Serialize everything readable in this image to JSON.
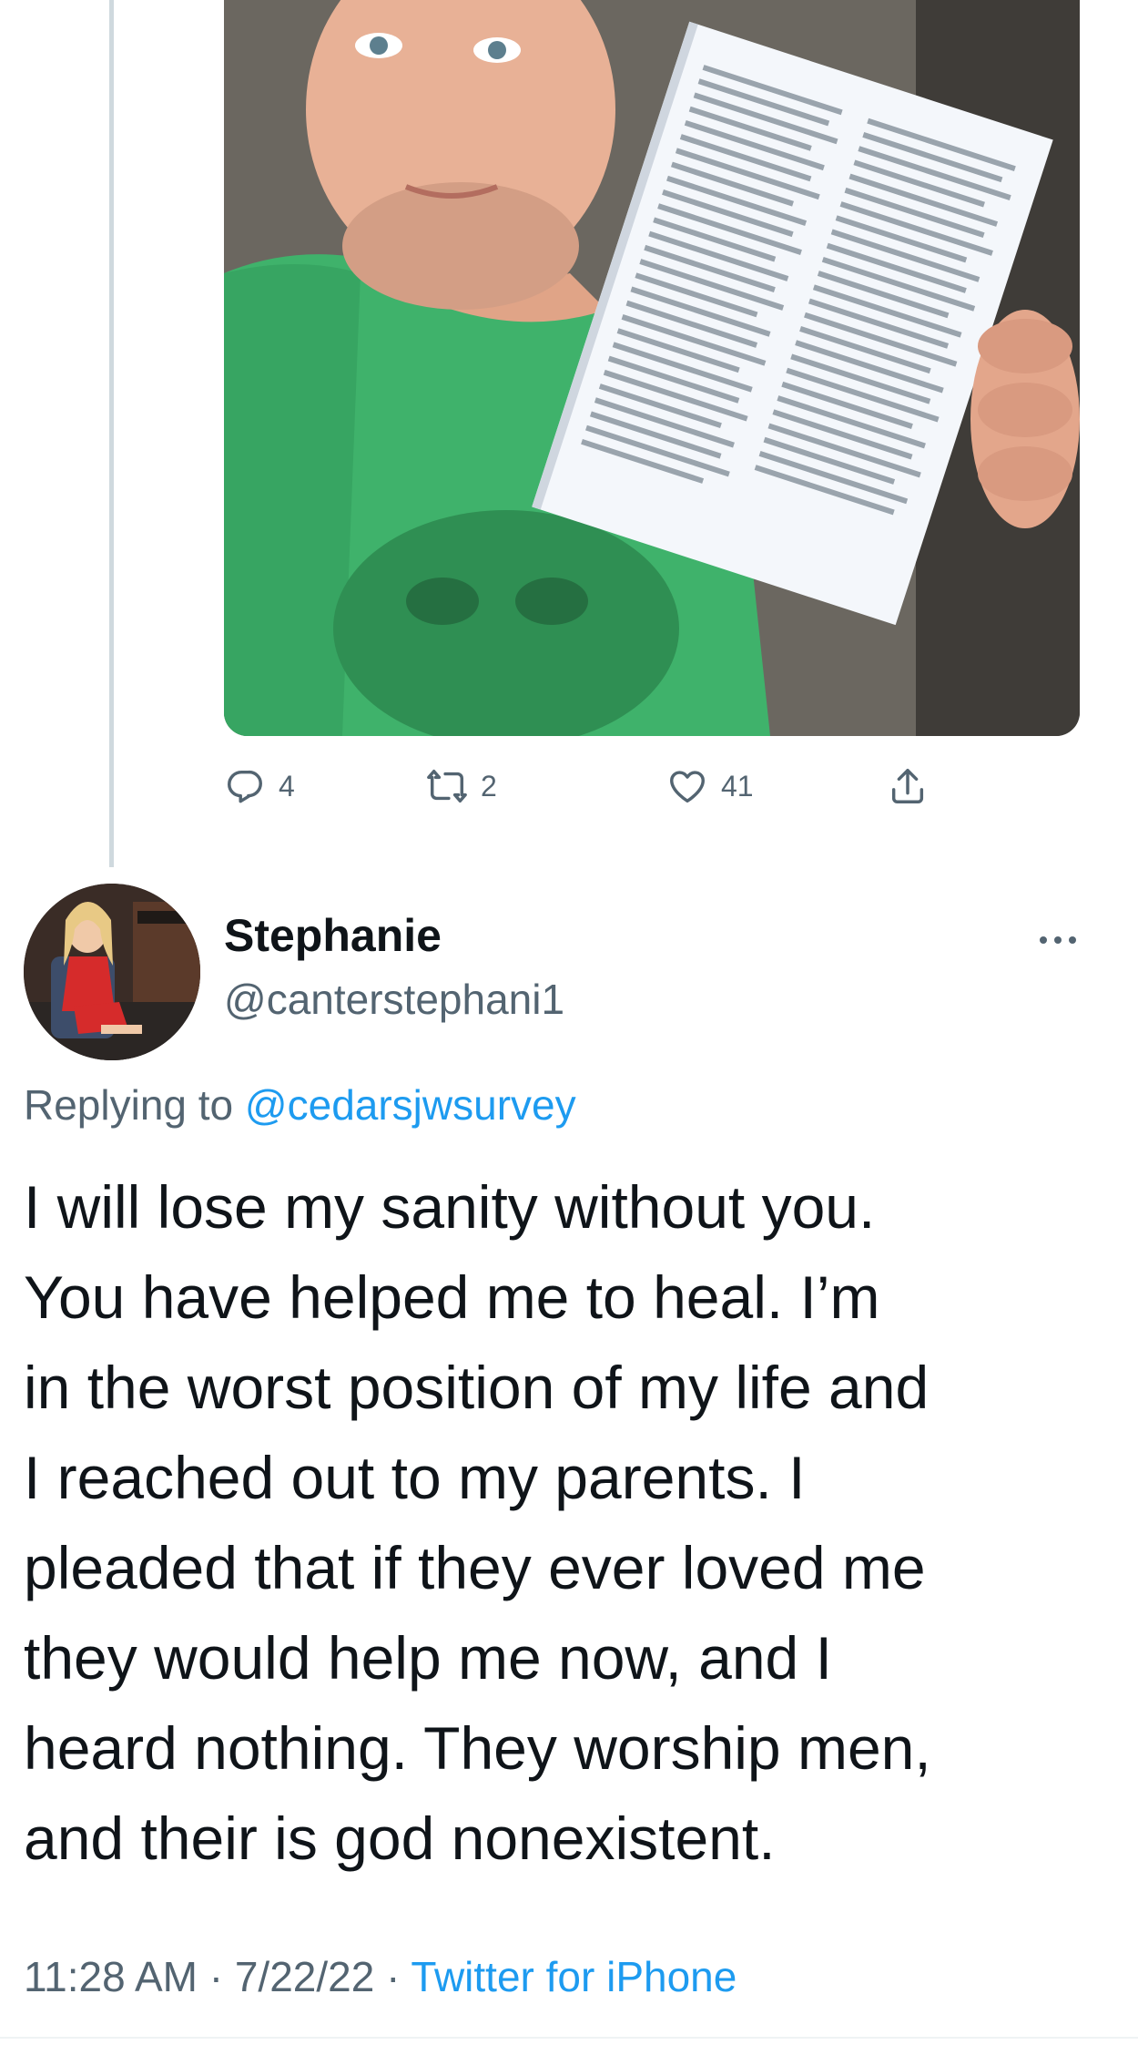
{
  "colors": {
    "text_primary": "#0f1419",
    "text_secondary": "#536471",
    "link": "#1d9bf0",
    "thread_line": "#cfd9de"
  },
  "parent_tweet": {
    "media_alt": "photo",
    "actions": {
      "reply": {
        "icon": "reply-icon",
        "count": "4"
      },
      "retweet": {
        "icon": "retweet-icon",
        "count": "2"
      },
      "like": {
        "icon": "heart-icon",
        "count": "41"
      },
      "share": {
        "icon": "share-icon"
      }
    }
  },
  "tweet": {
    "author": {
      "name": "Stephanie",
      "handle": "@canterstephani1",
      "avatar_icon": "avatar"
    },
    "more_icon": "more-icon",
    "replying_prefix": "Replying to ",
    "replying_to": "@cedarsjwsurvey",
    "text": "I will lose my sanity without you.\nYou have helped me to heal.  I’m\nin the worst position of my life and\nI reached out to my parents.  I\npleaded that if they ever loved me\nthey would help me now, and I\nheard nothing.  They worship men,\nand their is god nonexistent.",
    "time": "11:28 AM",
    "separator": " · ",
    "date": "7/22/22",
    "source": "Twitter for iPhone"
  }
}
